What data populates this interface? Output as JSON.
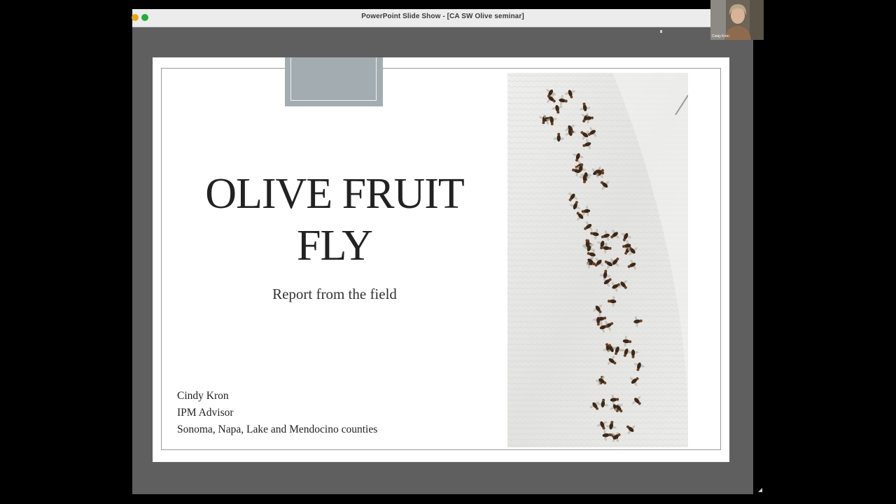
{
  "window": {
    "title": "PowerPoint Slide Show - [CA SW Olive seminar]"
  },
  "webcam": {
    "participant_name": "Cindy Kron"
  },
  "slide": {
    "title_line1": "OLIVE FRUIT",
    "title_line2": "FLY",
    "subtitle": "Report from the field",
    "presenter_name": "Cindy Kron",
    "presenter_role": "IPM Advisor",
    "presenter_region": "Sonoma, Napa, Lake and Mendocino counties"
  },
  "colors": {
    "slide_accent": "#a3adb1",
    "text": "#222222",
    "window_bg": "#5f5f5f"
  },
  "icons": [
    "minimize-icon",
    "maximize-icon",
    "resize-handle-icon"
  ]
}
